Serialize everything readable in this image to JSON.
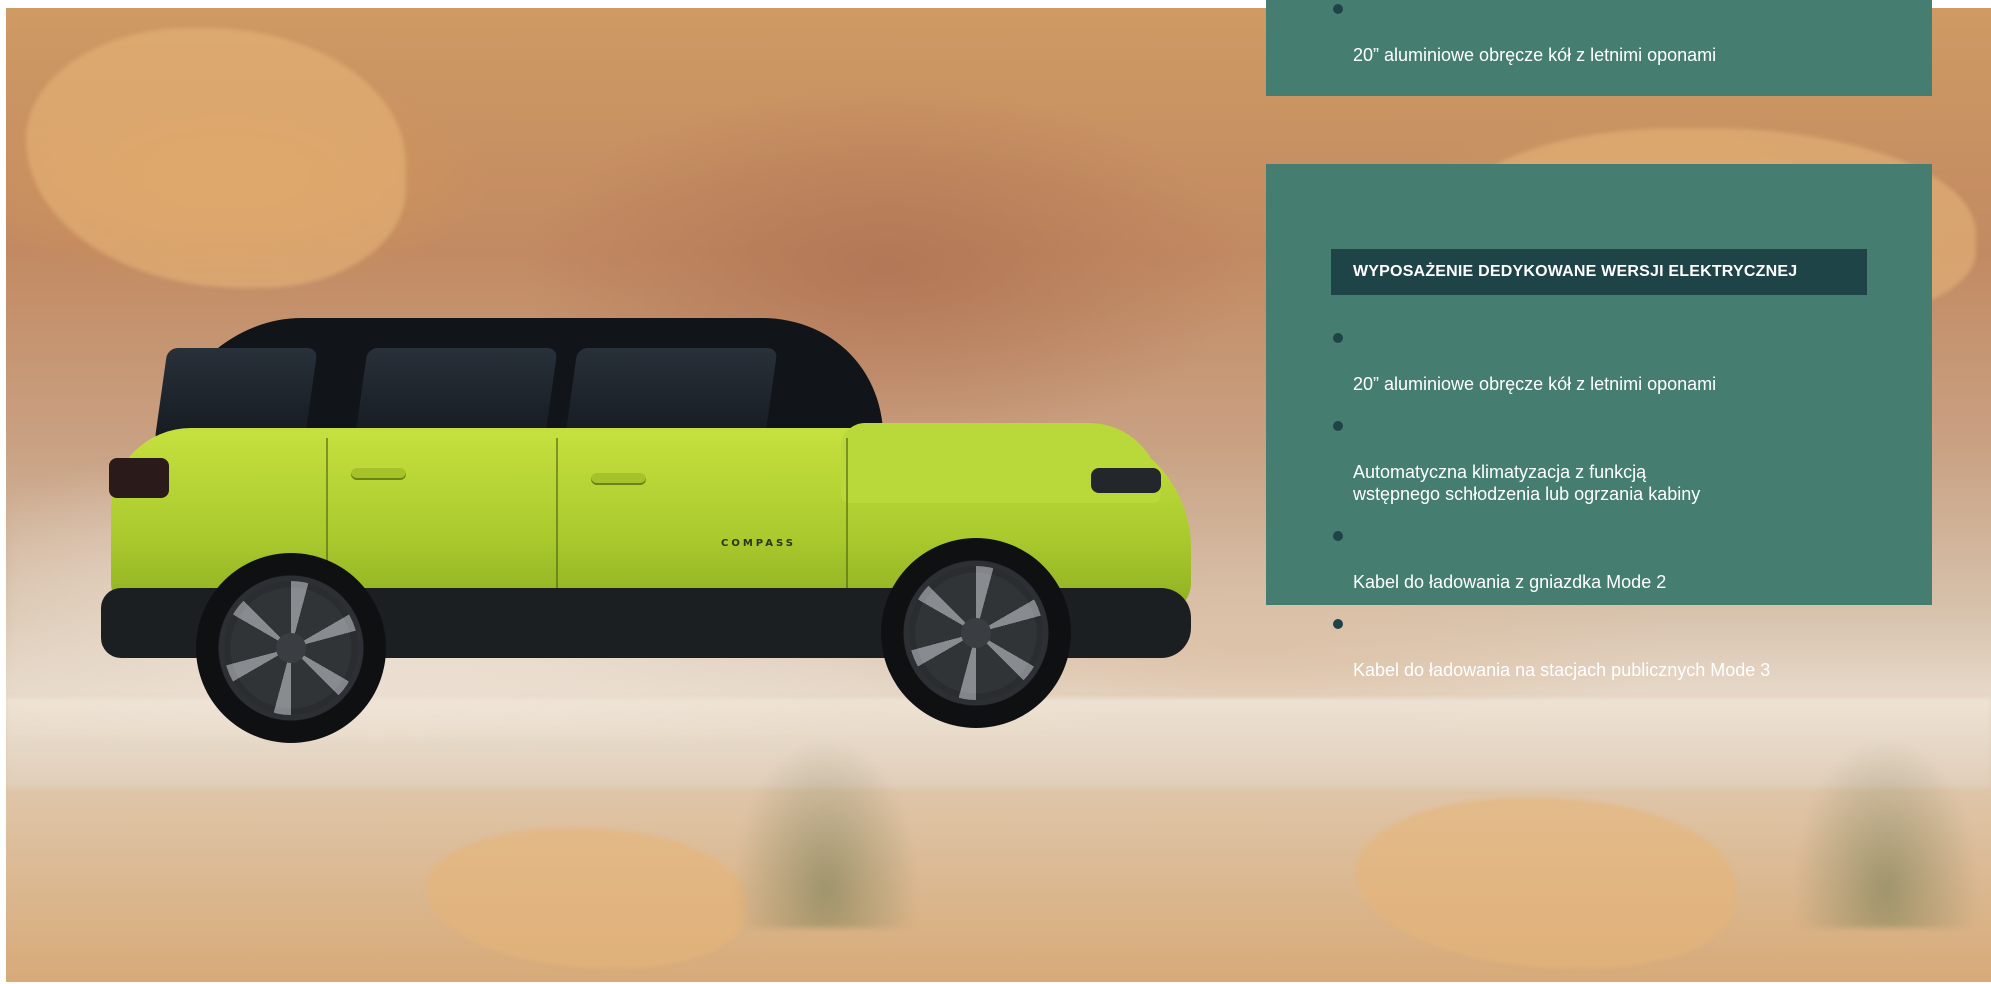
{
  "background": {
    "image": "jeep-compass-electric-offroad-photo",
    "car_badge": "COMPASS"
  },
  "colors": {
    "panel": "#457e70",
    "heading": "#1f4447",
    "bullet": "#1f4447",
    "text": "#ffffff",
    "car": "#b4d237"
  },
  "top_panel": {
    "items": [
      "20” aluminiowe obręcze kół z letnimi oponami"
    ]
  },
  "main_panel": {
    "heading": "WYPOSAŻENIE DEDYKOWANE WERSJI ELEKTRYCZNEJ",
    "items": [
      "20” aluminiowe obręcze kół z letnimi oponami",
      "Automatyczna klimatyzacja z funkcją\nwstępnego schłodzenia lub ogrzania kabiny",
      "Kabel do ładowania z gniazdka Mode 2",
      "Kabel do ładowania na stacjach publicznych Mode 3"
    ]
  }
}
